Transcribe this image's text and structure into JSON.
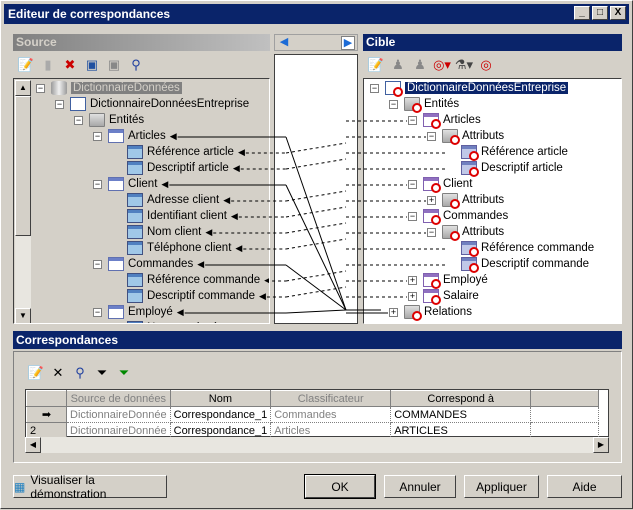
{
  "window": {
    "title": "Editeur de correspondances",
    "controls": [
      "_",
      "□",
      "X"
    ]
  },
  "source": {
    "header": "Source",
    "toolbar": [
      "properties-icon",
      "new-datasource-icon",
      "delete-datasource-icon",
      "add-model-icon",
      "model-disabled-icon",
      "find-icon"
    ],
    "tree": [
      {
        "label": "DictionnaireDonnées",
        "level": 0,
        "icon": "datasource",
        "expanded": true,
        "state": "gray-selected"
      },
      {
        "label": "DictionnaireDonnéesEntreprise",
        "level": 1,
        "icon": "dictionary",
        "expanded": true
      },
      {
        "label": "Entités",
        "level": 2,
        "icon": "folder",
        "expanded": true
      },
      {
        "label": "Articles",
        "level": 3,
        "icon": "entity",
        "expanded": true,
        "arrow": "solid"
      },
      {
        "label": "Référence article",
        "level": 4,
        "icon": "attribute",
        "arrow": "dashed"
      },
      {
        "label": "Descriptif article",
        "level": 4,
        "icon": "attribute",
        "arrow": "dashed"
      },
      {
        "label": "Client",
        "level": 3,
        "icon": "entity",
        "expanded": true,
        "arrow": "solid"
      },
      {
        "label": "Adresse client",
        "level": 4,
        "icon": "attribute",
        "arrow": "dashed"
      },
      {
        "label": "Identifiant client",
        "level": 4,
        "icon": "attribute",
        "arrow": "dashed"
      },
      {
        "label": "Nom client",
        "level": 4,
        "icon": "attribute",
        "arrow": "dashed"
      },
      {
        "label": "Téléphone client",
        "level": 4,
        "icon": "attribute",
        "arrow": "dashed"
      },
      {
        "label": "Commandes",
        "level": 3,
        "icon": "entity",
        "expanded": true,
        "arrow": "solid"
      },
      {
        "label": "Référence commande",
        "level": 4,
        "icon": "attribute",
        "arrow": "dashed"
      },
      {
        "label": "Descriptif commande",
        "level": 4,
        "icon": "attribute",
        "arrow": "dashed"
      },
      {
        "label": "Employé",
        "level": 3,
        "icon": "entity",
        "expanded": true,
        "arrow": "solid"
      },
      {
        "label": "Nom employé",
        "level": 4,
        "icon": "attribute",
        "arrow": "dashed"
      }
    ]
  },
  "middle": {
    "left_arrow": "◀",
    "right_arrow": "▶"
  },
  "target": {
    "header": "Cible",
    "toolbar": [
      "properties-icon",
      "users-disabled-icon",
      "users-disabled-icon-2",
      "filter-target-icon",
      "filter-icon",
      "find-target-icon"
    ],
    "tree": [
      {
        "label": "DictionnaireDonnéesEntreprise",
        "level": 0,
        "icon": "dictionary",
        "expanded": true,
        "state": "selected"
      },
      {
        "label": "Entités",
        "level": 1,
        "icon": "folder",
        "expanded": true
      },
      {
        "label": "Articles",
        "level": 2,
        "icon": "entity",
        "expanded": true
      },
      {
        "label": "Attributs",
        "level": 3,
        "icon": "folder",
        "expanded": true
      },
      {
        "label": "Référence article",
        "level": 4,
        "icon": "attribute"
      },
      {
        "label": "Descriptif article",
        "level": 4,
        "icon": "attribute"
      },
      {
        "label": "Client",
        "level": 2,
        "icon": "entity",
        "expanded": true
      },
      {
        "label": "Attributs",
        "level": 3,
        "icon": "folder",
        "expanded": false
      },
      {
        "label": "Commandes",
        "level": 2,
        "icon": "entity",
        "expanded": true
      },
      {
        "label": "Attributs",
        "level": 3,
        "icon": "folder",
        "expanded": true
      },
      {
        "label": "Référence commande",
        "level": 4,
        "icon": "attribute"
      },
      {
        "label": "Descriptif commande",
        "level": 4,
        "icon": "attribute"
      },
      {
        "label": "Employé",
        "level": 2,
        "icon": "entity",
        "expanded": false
      },
      {
        "label": "Salaire",
        "level": 2,
        "icon": "entity",
        "expanded": false
      },
      {
        "label": "Relations",
        "level": 1,
        "icon": "folder",
        "expanded": false
      }
    ]
  },
  "mappings": {
    "header": "Correspondances",
    "toolbar": [
      "properties-icon",
      "delete-icon",
      "find-icon",
      "filter-edit-icon",
      "filter-apply-icon"
    ],
    "columns": [
      "Source de données",
      "Nom",
      "Classificateur",
      "Correspond à"
    ],
    "rows": [
      {
        "marker": "➡",
        "source": "DictionnaireDonnée",
        "name": "Correspondance_1",
        "classifier": "Commandes",
        "maps_to": "COMMANDES"
      },
      {
        "marker": "2",
        "source": "DictionnaireDonnée",
        "name": "Correspondance_1",
        "classifier": "Articles",
        "maps_to": "ARTICLES"
      }
    ]
  },
  "buttons": {
    "demo": "Visualiser la démonstration",
    "ok": "OK",
    "cancel": "Annuler",
    "apply": "Appliquer",
    "help": "Aide"
  }
}
